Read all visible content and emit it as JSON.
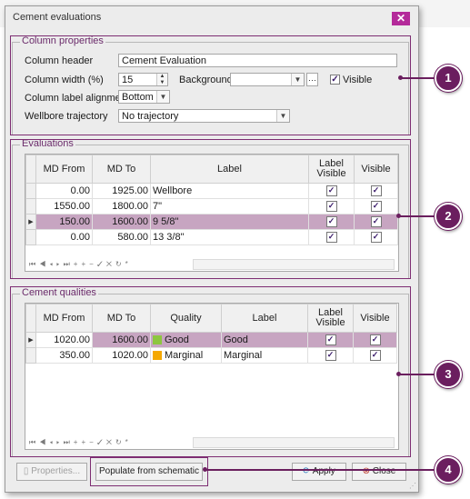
{
  "window": {
    "title": "Cement evaluations",
    "close_glyph": "✕"
  },
  "column_properties": {
    "group_label": "Column properties",
    "header_label": "Column header",
    "header_value": "Cement Evaluation",
    "width_label": "Column width (%)",
    "width_value": "15",
    "background_label": "Background",
    "background_value": "",
    "visible_label": "Visible",
    "visible_checked": true,
    "alignment_label": "Column label alignment",
    "alignment_value": "Bottom",
    "trajectory_label": "Wellbore trajectory",
    "trajectory_value": "No trajectory"
  },
  "evaluations": {
    "group_label": "Evaluations",
    "columns": [
      "MD From",
      "MD To",
      "Label",
      "Label Visible",
      "Visible"
    ],
    "rows": [
      {
        "md_from": "0.00",
        "md_to": "1925.00",
        "label": "Wellbore",
        "label_visible": true,
        "visible": true,
        "selected": false
      },
      {
        "md_from": "1550.00",
        "md_to": "1800.00",
        "label": "7\"",
        "label_visible": true,
        "visible": true,
        "selected": false
      },
      {
        "md_from": "150.00",
        "md_to": "1600.00",
        "label": "9 5/8\"",
        "label_visible": true,
        "visible": true,
        "selected": true
      },
      {
        "md_from": "0.00",
        "md_to": "580.00",
        "label": "13 3/8\"",
        "label_visible": true,
        "visible": true,
        "selected": false
      }
    ]
  },
  "cement_qualities": {
    "group_label": "Cement qualities",
    "columns": [
      "MD From",
      "MD To",
      "Quality",
      "Label",
      "Label Visible",
      "Visible"
    ],
    "rows": [
      {
        "md_from": "1020.00",
        "md_to": "1600.00",
        "quality": "Good",
        "quality_color": "#8dc63f",
        "label": "Good",
        "label_visible": true,
        "visible": true,
        "selected": true
      },
      {
        "md_from": "350.00",
        "md_to": "1020.00",
        "quality": "Marginal",
        "quality_color": "#f5a800",
        "label": "Marginal",
        "label_visible": true,
        "visible": true,
        "selected": false
      }
    ]
  },
  "navigator_icons": [
    "first-icon",
    "prev-page-icon",
    "prev-icon",
    "next-icon",
    "next-page-icon",
    "last-icon",
    "append-icon",
    "insert-icon",
    "delete-icon",
    "post-icon",
    "cancel-icon",
    "refresh-icon",
    "bookmark-icon"
  ],
  "buttons": {
    "properties": "Properties...",
    "populate": "Populate from schematic",
    "apply": "Apply",
    "close": "Close"
  },
  "callouts": [
    "1",
    "2",
    "3",
    "4"
  ],
  "colors": {
    "accent": "#6b1e5f",
    "selection": "#c7a5c1",
    "close_button": "#b42a9a"
  }
}
